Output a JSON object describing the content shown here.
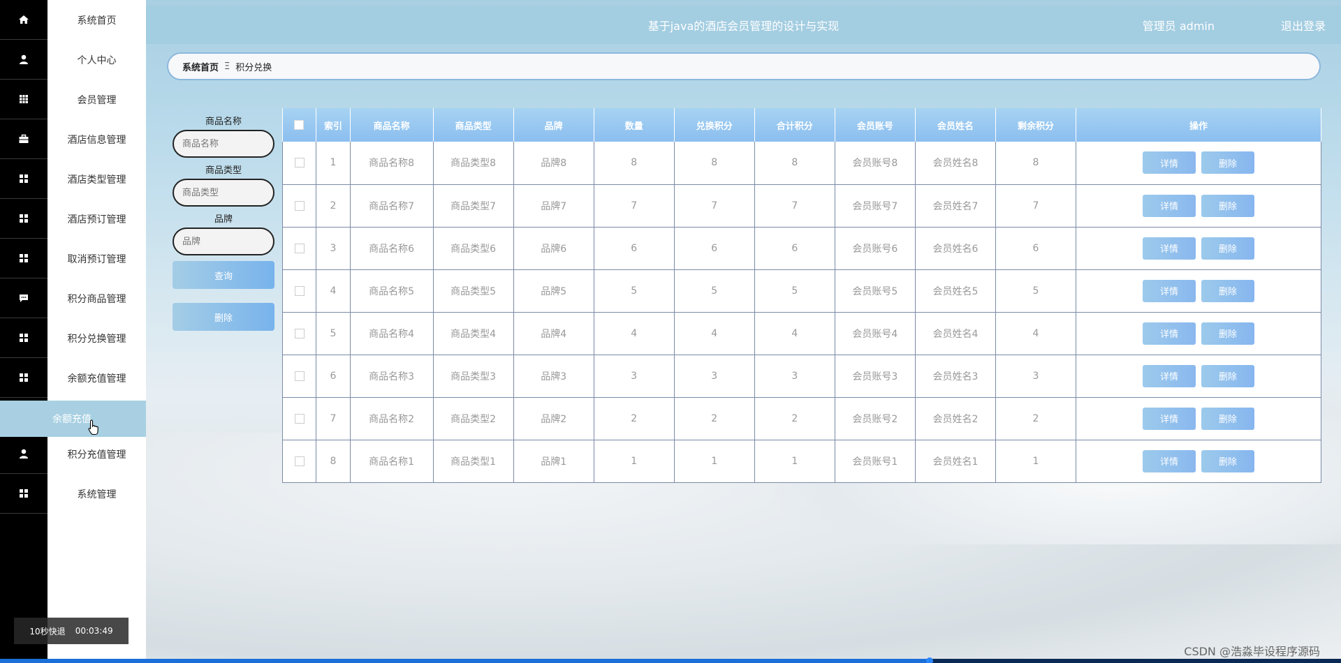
{
  "header": {
    "title": "基于java的酒店会员管理的设计与实现",
    "admin": "管理员 admin",
    "logout": "退出登录"
  },
  "breadcrumb": {
    "home": "系统首页",
    "separator": "Ξ",
    "current": "积分兑换"
  },
  "rail": {
    "icons": [
      "home-icon",
      "person-icon",
      "grid-icon",
      "briefcase-icon",
      "apps-icon",
      "apps-icon",
      "apps-icon",
      "chat-icon",
      "apps-icon",
      "apps-icon",
      "person-icon",
      "apps-icon"
    ]
  },
  "menu": {
    "items": [
      {
        "label": "系统首页"
      },
      {
        "label": "个人中心"
      },
      {
        "label": "会员管理"
      },
      {
        "label": "酒店信息管理"
      },
      {
        "label": "酒店类型管理"
      },
      {
        "label": "酒店预订管理"
      },
      {
        "label": "取消预订管理"
      },
      {
        "label": "积分商品管理"
      },
      {
        "label": "积分兑换管理"
      },
      {
        "label": "余额充值管理"
      },
      {
        "label": "积分充值管理"
      },
      {
        "label": "系统管理"
      }
    ],
    "submenu": {
      "label": "余额充值"
    }
  },
  "search": {
    "fields": [
      {
        "label": "商品名称",
        "placeholder": "商品名称"
      },
      {
        "label": "商品类型",
        "placeholder": "商品类型"
      },
      {
        "label": "品牌",
        "placeholder": "品牌"
      }
    ],
    "query_button": "查询",
    "delete_button": "删除"
  },
  "table": {
    "headers": [
      "索引",
      "商品名称",
      "商品类型",
      "品牌",
      "数量",
      "兑换积分",
      "合计积分",
      "会员账号",
      "会员姓名",
      "剩余积分",
      "操作"
    ],
    "detail_label": "详情",
    "delete_label": "删除",
    "rows": [
      [
        "1",
        "商品名称8",
        "商品类型8",
        "品牌8",
        "8",
        "8",
        "8",
        "会员账号8",
        "会员姓名8",
        "8"
      ],
      [
        "2",
        "商品名称7",
        "商品类型7",
        "品牌7",
        "7",
        "7",
        "7",
        "会员账号7",
        "会员姓名7",
        "7"
      ],
      [
        "3",
        "商品名称6",
        "商品类型6",
        "品牌6",
        "6",
        "6",
        "6",
        "会员账号6",
        "会员姓名6",
        "6"
      ],
      [
        "4",
        "商品名称5",
        "商品类型5",
        "品牌5",
        "5",
        "5",
        "5",
        "会员账号5",
        "会员姓名5",
        "5"
      ],
      [
        "5",
        "商品名称4",
        "商品类型4",
        "品牌4",
        "4",
        "4",
        "4",
        "会员账号4",
        "会员姓名4",
        "4"
      ],
      [
        "6",
        "商品名称3",
        "商品类型3",
        "品牌3",
        "3",
        "3",
        "3",
        "会员账号3",
        "会员姓名3",
        "3"
      ],
      [
        "7",
        "商品名称2",
        "商品类型2",
        "品牌2",
        "2",
        "2",
        "2",
        "会员账号2",
        "会员姓名2",
        "2"
      ],
      [
        "8",
        "商品名称1",
        "商品类型1",
        "品牌1",
        "1",
        "1",
        "1",
        "会员账号1",
        "会员姓名1",
        "1"
      ]
    ]
  },
  "video": {
    "skip_label": "10秒快退",
    "time": "00:03:49",
    "watermark": "CSDN @浩淼毕设程序源码"
  },
  "colors": {
    "accent": "#a3cde1",
    "button": "#8ab8ee",
    "rail": "#000000"
  }
}
